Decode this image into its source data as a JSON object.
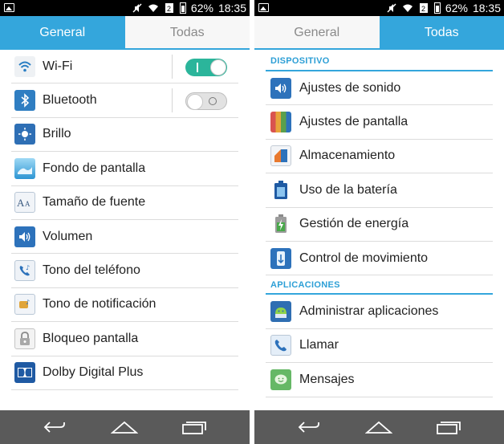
{
  "status_bar": {
    "battery": "62%",
    "time": "18:35"
  },
  "left_screen": {
    "tabs": [
      {
        "label": "General"
      },
      {
        "label": "Todas"
      }
    ],
    "items": [
      {
        "label": "Wi-Fi",
        "icon": "wifi-icon",
        "toggle": "on"
      },
      {
        "label": "Bluetooth",
        "icon": "bluetooth-icon",
        "toggle": "off"
      },
      {
        "label": "Brillo",
        "icon": "brightness-icon"
      },
      {
        "label": "Fondo de pantalla",
        "icon": "wallpaper-icon"
      },
      {
        "label": "Tamaño de fuente",
        "icon": "font-size-icon"
      },
      {
        "label": "Volumen",
        "icon": "volume-icon"
      },
      {
        "label": "Tono del teléfono",
        "icon": "ringtone-icon"
      },
      {
        "label": "Tono de notificación",
        "icon": "notification-icon"
      },
      {
        "label": "Bloqueo pantalla",
        "icon": "lock-icon"
      },
      {
        "label": "Dolby Digital Plus",
        "icon": "dolby-icon"
      }
    ]
  },
  "right_screen": {
    "tabs": [
      {
        "label": "General"
      },
      {
        "label": "Todas"
      }
    ],
    "sections": [
      {
        "title": "DISPOSITIVO",
        "items": [
          {
            "label": "Ajustes de sonido",
            "icon": "sound-icon"
          },
          {
            "label": "Ajustes de pantalla",
            "icon": "display-icon"
          },
          {
            "label": "Almacenamiento",
            "icon": "storage-icon"
          },
          {
            "label": "Uso de la batería",
            "icon": "battery-icon"
          },
          {
            "label": "Gestión de energía",
            "icon": "power-management-icon"
          },
          {
            "label": "Control de movimiento",
            "icon": "motion-control-icon"
          }
        ]
      },
      {
        "title": "APLICACIONES",
        "items": [
          {
            "label": "Administrar aplicaciones",
            "icon": "android-icon"
          },
          {
            "label": "Llamar",
            "icon": "phone-icon"
          },
          {
            "label": "Mensajes",
            "icon": "messages-icon"
          }
        ]
      }
    ]
  },
  "colors": {
    "accent": "#34a6dc",
    "toggle_on": "#2bb59b",
    "navbar": "#5a5a5a"
  }
}
